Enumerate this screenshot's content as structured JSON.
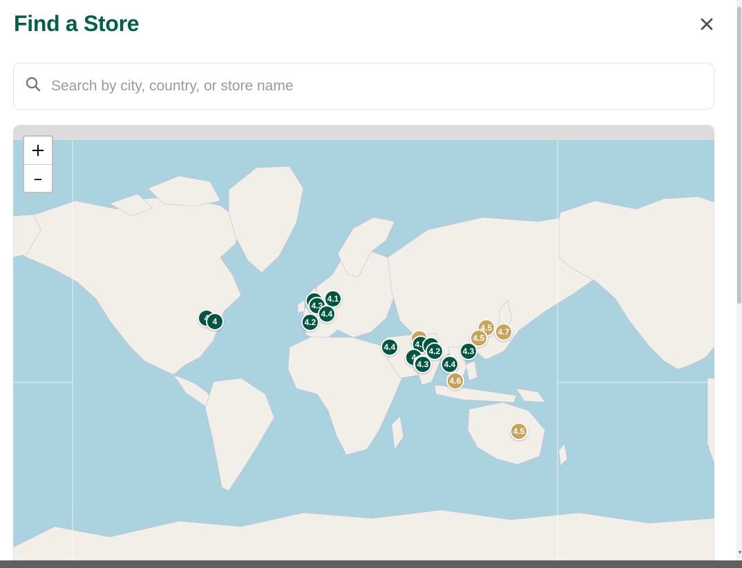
{
  "modal": {
    "title": "Find a Store",
    "close_icon": "close-icon"
  },
  "search": {
    "icon": "search-icon",
    "placeholder": "Search by city, country, or store name",
    "value": ""
  },
  "map": {
    "zoom_in_label": "+",
    "zoom_out_label": "–",
    "colors": {
      "water": "#aad3df",
      "land": "#f2efe9",
      "marker_green": "#00563f",
      "marker_gold": "#c9a35b"
    },
    "markers": [
      {
        "rating": "4",
        "color": "green",
        "region": "US East"
      },
      {
        "rating": "4",
        "color": "green",
        "region": "US East"
      },
      {
        "rating": "4",
        "color": "green",
        "region": "UK"
      },
      {
        "rating": "4.1",
        "color": "green",
        "region": "Europe"
      },
      {
        "rating": "4.3",
        "color": "green",
        "region": "Europe"
      },
      {
        "rating": "4.4",
        "color": "green",
        "region": "Europe"
      },
      {
        "rating": "4.2",
        "color": "green",
        "region": "Spain"
      },
      {
        "rating": "4.4",
        "color": "green",
        "region": "Middle East"
      },
      {
        "rating": "4",
        "color": "gold",
        "region": "India"
      },
      {
        "rating": "4.2",
        "color": "green",
        "region": "India"
      },
      {
        "rating": "4",
        "color": "green",
        "region": "India"
      },
      {
        "rating": "4.2",
        "color": "green",
        "region": "India"
      },
      {
        "rating": "4",
        "color": "green",
        "region": "India"
      },
      {
        "rating": "4",
        "color": "gold",
        "region": "India"
      },
      {
        "rating": "4.3",
        "color": "green",
        "region": "India"
      },
      {
        "rating": "4.4",
        "color": "green",
        "region": "SE Asia"
      },
      {
        "rating": "4.3",
        "color": "green",
        "region": "Philippines"
      },
      {
        "rating": "4.5",
        "color": "gold",
        "region": "China"
      },
      {
        "rating": "4.5",
        "color": "gold",
        "region": "China"
      },
      {
        "rating": "4.7",
        "color": "gold",
        "region": "Japan"
      },
      {
        "rating": "4.6",
        "color": "gold",
        "region": "Indonesia"
      },
      {
        "rating": "4.5",
        "color": "gold",
        "region": "Australia"
      }
    ]
  }
}
